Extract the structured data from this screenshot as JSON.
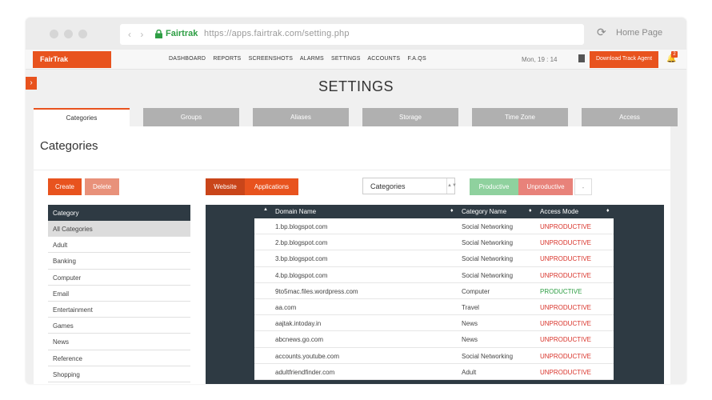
{
  "browser": {
    "nav_arrows": "‹ ›",
    "site_name": "Fairtrak",
    "url": "https://apps.fairtrak.com/setting.php",
    "home_label": "Home Page",
    "reload_icon": "⟳"
  },
  "app": {
    "logo": "FairTrak",
    "menu": [
      "DASHBOARD",
      "REPORTS",
      "SCREENSHOTS",
      "ALARMS",
      "SETTINGS",
      "ACCOUNTS",
      "F.A.QS"
    ],
    "date": "Mon, 19 : 14",
    "download_label": "Download Track Agent",
    "bell_icon": "bell-icon",
    "bell_count": "2",
    "accent_color": "#e8531e"
  },
  "page": {
    "title": "SETTINGS",
    "expand_icon": "›",
    "tabs": [
      "Categories",
      "Groups",
      "Aliases",
      "Storage",
      "Time Zone",
      "Access"
    ],
    "section_title": "Categories"
  },
  "actions": {
    "create": "Create",
    "delete": "Delete",
    "website": "Website",
    "applications": "Applications",
    "category_select": "Categories",
    "productive": "Productive",
    "unproductive": "Unproductive",
    "neutral": "-"
  },
  "category_list": {
    "header": "Category",
    "items": [
      "All Categories",
      "Adult",
      "Banking",
      "Computer",
      "Email",
      "Entertainment",
      "Games",
      "News",
      "Reference",
      "Shopping"
    ]
  },
  "domain_table": {
    "columns": [
      "Domain Name",
      "Category Name",
      "Access Mode"
    ],
    "rows": [
      {
        "domain": "1.bp.blogspot.com",
        "category": "Social Networking",
        "mode": "UNPRODUCTIVE"
      },
      {
        "domain": "2.bp.blogspot.com",
        "category": "Social Networking",
        "mode": "UNPRODUCTIVE"
      },
      {
        "domain": "3.bp.blogspot.com",
        "category": "Social Networking",
        "mode": "UNPRODUCTIVE"
      },
      {
        "domain": "4.bp.blogspot.com",
        "category": "Social Networking",
        "mode": "UNPRODUCTIVE"
      },
      {
        "domain": "9to5mac.files.wordpress.com",
        "category": "Computer",
        "mode": "PRODUCTIVE"
      },
      {
        "domain": "aa.com",
        "category": "Travel",
        "mode": "UNPRODUCTIVE"
      },
      {
        "domain": "aajtak.intoday.in",
        "category": "News",
        "mode": "UNPRODUCTIVE"
      },
      {
        "domain": "abcnews.go.com",
        "category": "News",
        "mode": "UNPRODUCTIVE"
      },
      {
        "domain": "accounts.youtube.com",
        "category": "Social Networking",
        "mode": "UNPRODUCTIVE"
      },
      {
        "domain": "adultfriendfinder.com",
        "category": "Adult",
        "mode": "UNPRODUCTIVE"
      }
    ]
  }
}
